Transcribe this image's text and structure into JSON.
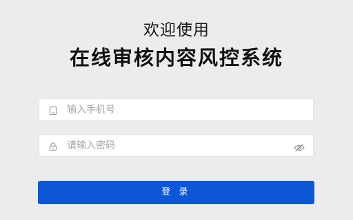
{
  "header": {
    "welcome": "欢迎使用",
    "title": "在线审核内容风控系统"
  },
  "form": {
    "phone": {
      "placeholder": "输入手机号",
      "value": "",
      "icon": "phone-icon"
    },
    "password": {
      "placeholder": "请输入密码",
      "value": "",
      "icon": "lock-icon",
      "toggle_icon": "eye-icon"
    },
    "submit_label": "登 录"
  },
  "colors": {
    "background": "#ececec",
    "accent": "#0b57d8",
    "icon": "#9a9a9a"
  }
}
